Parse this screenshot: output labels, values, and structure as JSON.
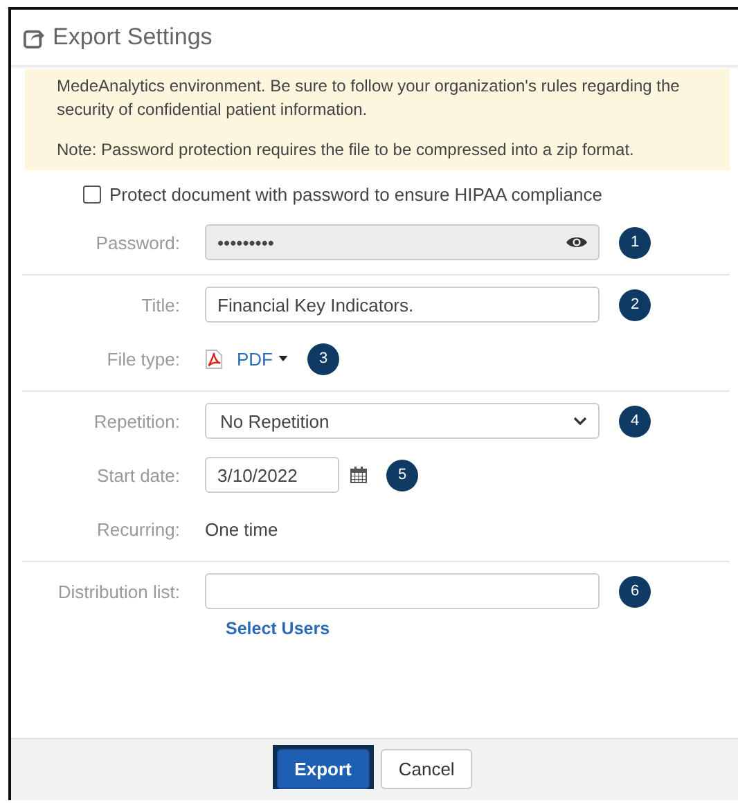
{
  "dialog": {
    "title": "Export Settings"
  },
  "notice": {
    "paragraphs": [
      "MedeAnalytics environment. Be sure to follow your organization's rules regarding the security of confidential patient information.",
      "Note: Password protection requires the file to be compressed into a zip format."
    ]
  },
  "sections": [
    {
      "rows": [
        {
          "kind": "checkbox",
          "label": "Protect document with password to ensure HIPAA compliance",
          "checked": false
        },
        {
          "kind": "password",
          "label": "Password:",
          "value": "•••••••••",
          "disabled": true,
          "badge": "1"
        }
      ]
    },
    {
      "rows": [
        {
          "kind": "text",
          "label": "Title:",
          "value": "Financial Key Indicators.",
          "badge": "2"
        },
        {
          "kind": "filetype",
          "label": "File type:",
          "value": "PDF",
          "badge": "3"
        }
      ]
    },
    {
      "rows": [
        {
          "kind": "select",
          "label": "Repetition:",
          "value": "No Repetition",
          "badge": "4"
        },
        {
          "kind": "date",
          "label": "Start date:",
          "value": "3/10/2022",
          "badge": "5"
        },
        {
          "kind": "static",
          "label": "Recurring:",
          "value": "One time"
        }
      ]
    },
    {
      "rows": [
        {
          "kind": "text",
          "label": "Distribution list:",
          "value": "",
          "badge": "6",
          "link": "Select Users"
        }
      ]
    }
  ],
  "buttons": [
    {
      "label": "Export",
      "primary": true,
      "highlighted": true
    },
    {
      "label": "Cancel",
      "primary": false,
      "highlighted": false
    }
  ]
}
